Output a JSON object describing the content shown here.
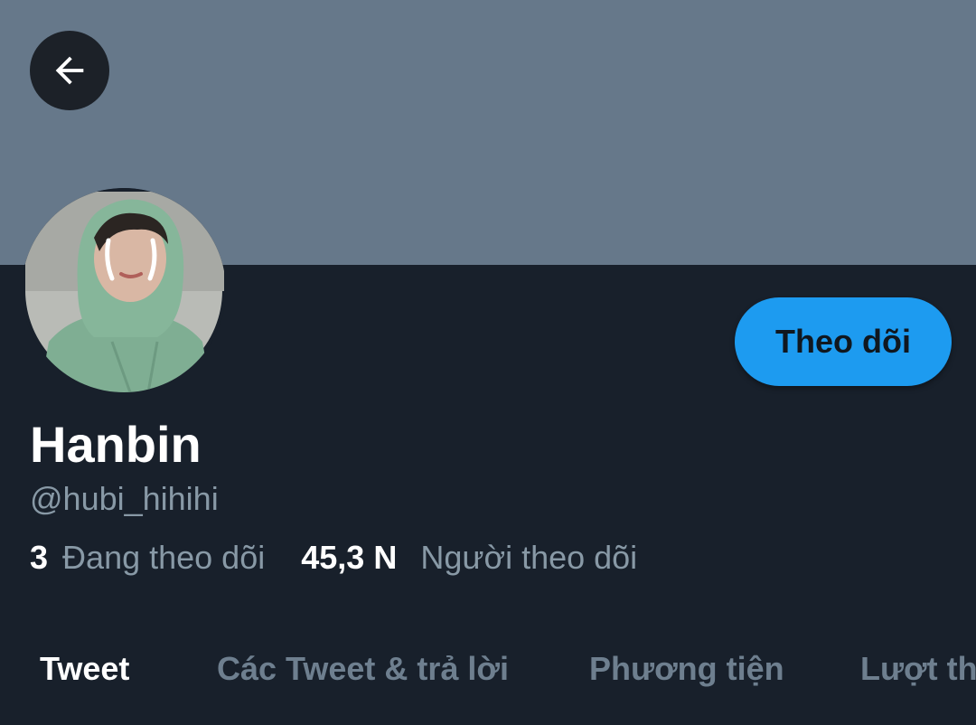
{
  "profile": {
    "name": "Hanbin",
    "handle": "@hubi_hihihi",
    "following_count": "3",
    "following_label": "Đang theo dõi",
    "followers_count": "45,3 N",
    "followers_label": "Người theo dõi"
  },
  "actions": {
    "follow_label": "Theo dõi"
  },
  "tabs": [
    {
      "label": "Tweet",
      "active": true
    },
    {
      "label": "Các Tweet & trả lời",
      "active": false
    },
    {
      "label": "Phương tiện",
      "active": false
    },
    {
      "label": "Lượt thích",
      "active": false
    }
  ],
  "colors": {
    "banner": "#66788a",
    "background": "#18202b",
    "accent": "#1d9bf0",
    "muted_text": "#8899a6"
  },
  "icons": {
    "back": "arrow-left-icon"
  }
}
